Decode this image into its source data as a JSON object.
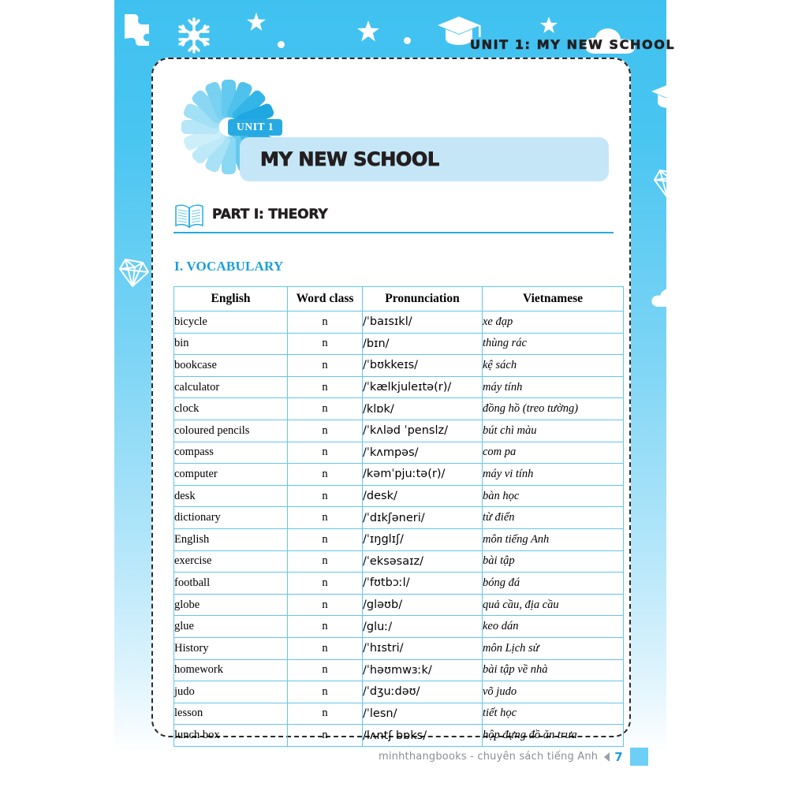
{
  "banner": {
    "unit_heading": "UNIT 1: MY NEW SCHOOL",
    "decorations": [
      "puzzle-piece-icon",
      "snowflake-icon",
      "star-icon",
      "moon-icon",
      "star-icon",
      "graduation-cap-icon",
      "star-icon",
      "cloud-icon",
      "graduation-cap-icon",
      "diamond-icon",
      "cloud-icon",
      "diamond-icon"
    ]
  },
  "worksheet": {
    "unit_badge": "UNIT 1",
    "unit_title": "MY NEW SCHOOL",
    "part_heading": "PART I: THEORY",
    "section_heading": "I. VOCABULARY",
    "book_icon": "open-book-icon",
    "logo_icon": "pinwheel-fan-icon"
  },
  "table": {
    "headers": [
      "English",
      "Word class",
      "Pronunciation",
      "Vietnamese"
    ],
    "rows": [
      [
        "bicycle",
        "n",
        "/ˈbaɪsɪkl/",
        "xe đạp"
      ],
      [
        "bin",
        "n",
        "/bɪn/",
        "thùng rác"
      ],
      [
        "bookcase",
        "n",
        "/ˈbʊkkeɪs/",
        "kệ sách"
      ],
      [
        "calculator",
        "n",
        "/ˈkælkjuleɪtə(r)/",
        "máy tính"
      ],
      [
        "clock",
        "n",
        "/klɒk/",
        "đồng hồ (treo tường)"
      ],
      [
        "coloured pencils",
        "n",
        "/ˈkʌləd ˈpenslz/",
        "bút chì màu"
      ],
      [
        "compass",
        "n",
        "/ˈkʌmpəs/",
        "com pa"
      ],
      [
        "computer",
        "n",
        "/kəmˈpjuːtə(r)/",
        "máy vi tính"
      ],
      [
        "desk",
        "n",
        "/desk/",
        "bàn học"
      ],
      [
        "dictionary",
        "n",
        "/ˈdɪkʃəneri/",
        "từ điển"
      ],
      [
        "English",
        "n",
        "/ˈɪŋglɪʃ/",
        "môn tiếng Anh"
      ],
      [
        "exercise",
        "n",
        "/ˈeksəsaɪz/",
        "bài tập"
      ],
      [
        "football",
        "n",
        "/ˈfʊtbɔːl/",
        "bóng đá"
      ],
      [
        "globe",
        "n",
        "/gləʊb/",
        "quả cầu, địa cầu"
      ],
      [
        "glue",
        "n",
        "/gluː/",
        "keo dán"
      ],
      [
        "History",
        "n",
        "/ˈhɪstri/",
        "môn Lịch sử"
      ],
      [
        "homework",
        "n",
        "/ˈhəʊmwɜːk/",
        "bài tập về nhà"
      ],
      [
        "judo",
        "n",
        "/ˈdʒuːdəʊ/",
        "võ judo"
      ],
      [
        "lesson",
        "n",
        "/ˈlesn/",
        "tiết học"
      ],
      [
        "lunch box",
        "n",
        "/lʌntʃ bɒks/",
        "hộp đựng đồ ăn trưa"
      ]
    ]
  },
  "footer": {
    "text": "minhthangbooks - chuyên sách tiếng Anh",
    "page_number": "7",
    "arrow_icon": "left-triangle-icon"
  },
  "colors": {
    "banner_blue": "#3fc1f0",
    "accent_blue": "#27aae1",
    "title_bar": "#c5e6f7",
    "table_border": "#62c6ea",
    "heading_blue": "#1b9fd8",
    "footer_gray": "#8a8f94"
  }
}
